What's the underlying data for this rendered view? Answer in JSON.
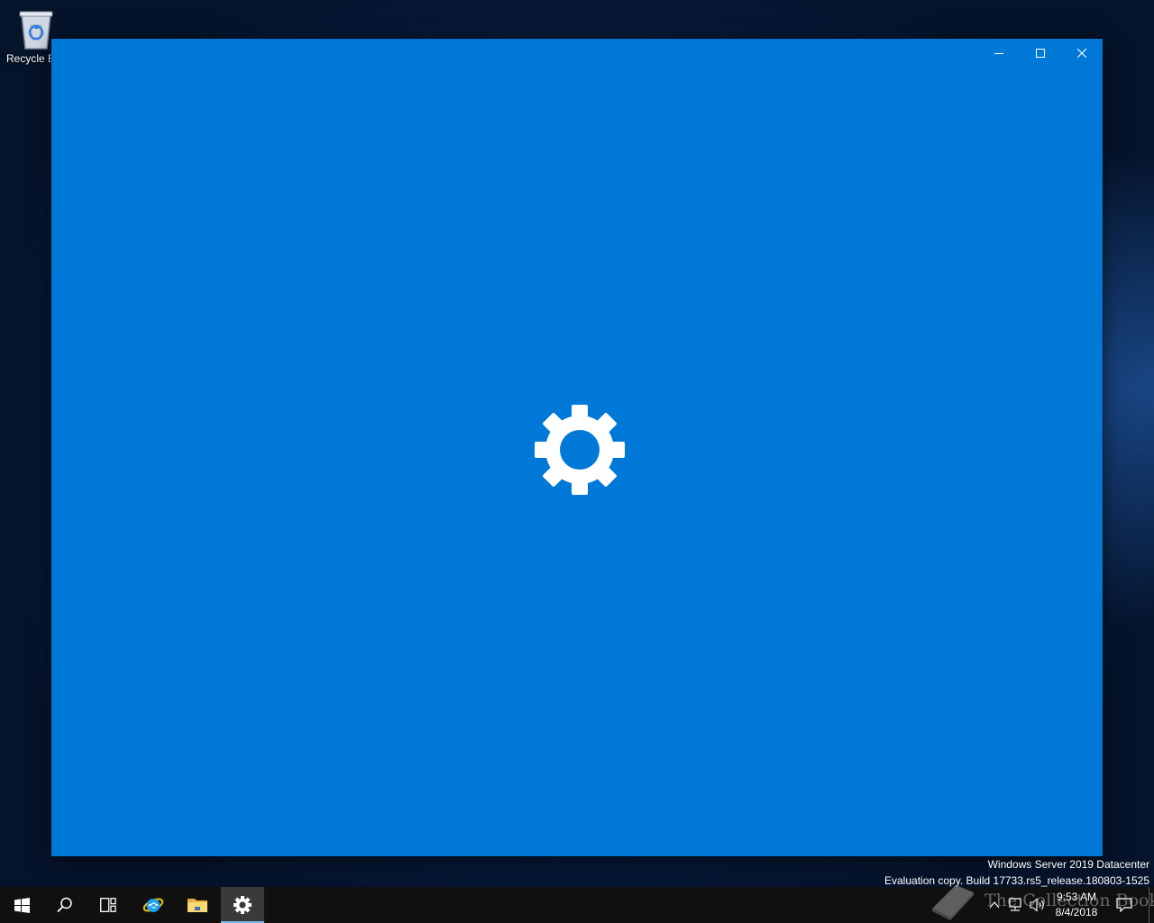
{
  "desktop": {
    "recycle_bin_label": "Recycle B"
  },
  "window": {
    "minimize_icon": "minimize-icon",
    "maximize_icon": "maximize-icon",
    "close_icon": "close-icon",
    "splash_icon": "gear-icon",
    "accent_color": "#0078d7"
  },
  "watermark": {
    "line1": "Windows Server 2019 Datacenter",
    "line2": "Evaluation copy. Build 17733.rs5_release.180803-1525"
  },
  "taskbar": {
    "items": [
      {
        "name": "start-button",
        "icon": "windows-logo-icon"
      },
      {
        "name": "search-button",
        "icon": "search-icon"
      },
      {
        "name": "task-view-button",
        "icon": "task-view-icon"
      },
      {
        "name": "internet-explorer-button",
        "icon": "internet-explorer-icon"
      },
      {
        "name": "file-explorer-button",
        "icon": "folder-icon"
      },
      {
        "name": "settings-taskbar-button",
        "icon": "gear-icon"
      }
    ],
    "clock": {
      "time": "9:53 AM",
      "date": "8/4/2018"
    }
  },
  "overlay": {
    "text": "The Collection Book"
  }
}
